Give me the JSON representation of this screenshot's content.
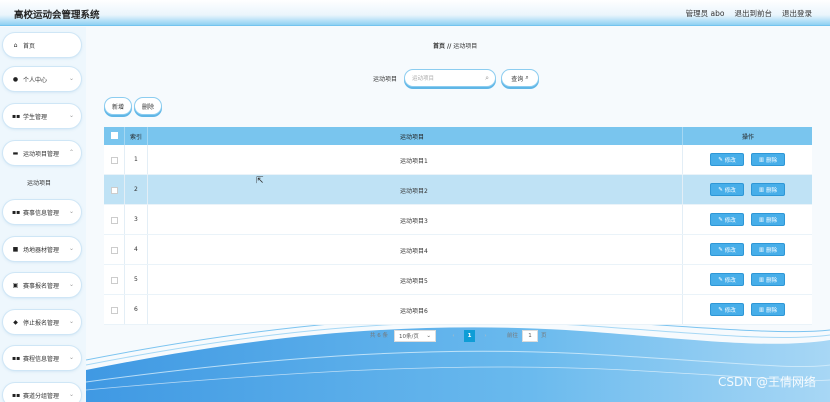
{
  "header": {
    "app_title": "高校运动会管理系统",
    "user": "管理员 abo",
    "back_to_front": "退出到前台",
    "logout": "退出登录"
  },
  "sidebar": {
    "items": [
      {
        "label": "首页",
        "icon": "home-icon"
      },
      {
        "label": "个人中心",
        "icon": "user-icon"
      },
      {
        "label": "学生管理",
        "icon": "grid-icon"
      },
      {
        "label": "运动项目管理",
        "icon": "ticket-icon"
      },
      {
        "label": "赛事信息管理",
        "icon": "grid-icon"
      },
      {
        "label": "场地器材管理",
        "icon": "lock-icon"
      },
      {
        "label": "赛事报名管理",
        "icon": "doc-icon"
      },
      {
        "label": "停止报名管理",
        "icon": "leaf-icon"
      },
      {
        "label": "赛程信息管理",
        "icon": "grid-icon"
      },
      {
        "label": "赛道分组管理",
        "icon": "grid-icon"
      }
    ],
    "sub_item": "运动项目"
  },
  "breadcrumb": {
    "home": "首页",
    "sep": "//",
    "current": "运动项目"
  },
  "search": {
    "label": "运动项目",
    "placeholder": "运动项目",
    "button": "查询"
  },
  "actions": {
    "add": "新增",
    "delete": "删除"
  },
  "table": {
    "headers": {
      "index": "索引",
      "name": "运动项目",
      "ops": "操作"
    },
    "rows": [
      {
        "index": "1",
        "name": "运动项目1"
      },
      {
        "index": "2",
        "name": "运动项目2"
      },
      {
        "index": "3",
        "name": "运动项目3"
      },
      {
        "index": "4",
        "name": "运动项目4"
      },
      {
        "index": "5",
        "name": "运动项目5"
      },
      {
        "index": "6",
        "name": "运动项目6"
      }
    ],
    "edit": "修改",
    "del": "删除"
  },
  "pagination": {
    "total": "共 6 条",
    "page_size": "10条/页",
    "current_page": "1",
    "goto_label": "前往",
    "goto_value": "1",
    "page_suffix": "页"
  },
  "watermark": "CSDN @王倩网络",
  "colors": {
    "accent": "#47aee9",
    "header": "#79c5ee",
    "highlight_row": "#bfe2f5"
  }
}
